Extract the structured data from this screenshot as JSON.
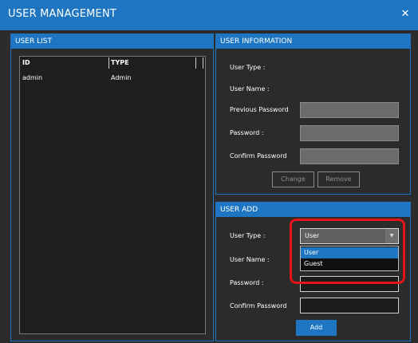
{
  "window": {
    "title": "USER MANAGEMENT",
    "close_glyph": "✕"
  },
  "user_list": {
    "header": "USER LIST",
    "columns": [
      "ID",
      "TYPE"
    ],
    "rows": [
      {
        "id": "admin",
        "type": "Admin"
      }
    ]
  },
  "user_info": {
    "header": "USER INFORMATION",
    "labels": {
      "user_type": "User Type :",
      "user_name": "User Name :",
      "previous_password": "Previous Password",
      "password": "Password :",
      "confirm_password": "Confirm Password"
    },
    "buttons": {
      "change": "Change",
      "remove": "Remove"
    }
  },
  "user_add": {
    "header": "USER ADD",
    "labels": {
      "user_type": "User Type :",
      "user_name": "User Name :",
      "password": "Password :",
      "confirm_password": "Confirm Password"
    },
    "user_type_select": {
      "value": "User",
      "options": [
        "User",
        "Guest"
      ],
      "arrow_icon": "chevron-down-icon"
    },
    "buttons": {
      "add": "Add"
    }
  },
  "colors": {
    "accent": "#1e76c2",
    "background": "#2c2c2c",
    "highlight": "#e5141a",
    "disabled_field": "#6b6b6b"
  }
}
